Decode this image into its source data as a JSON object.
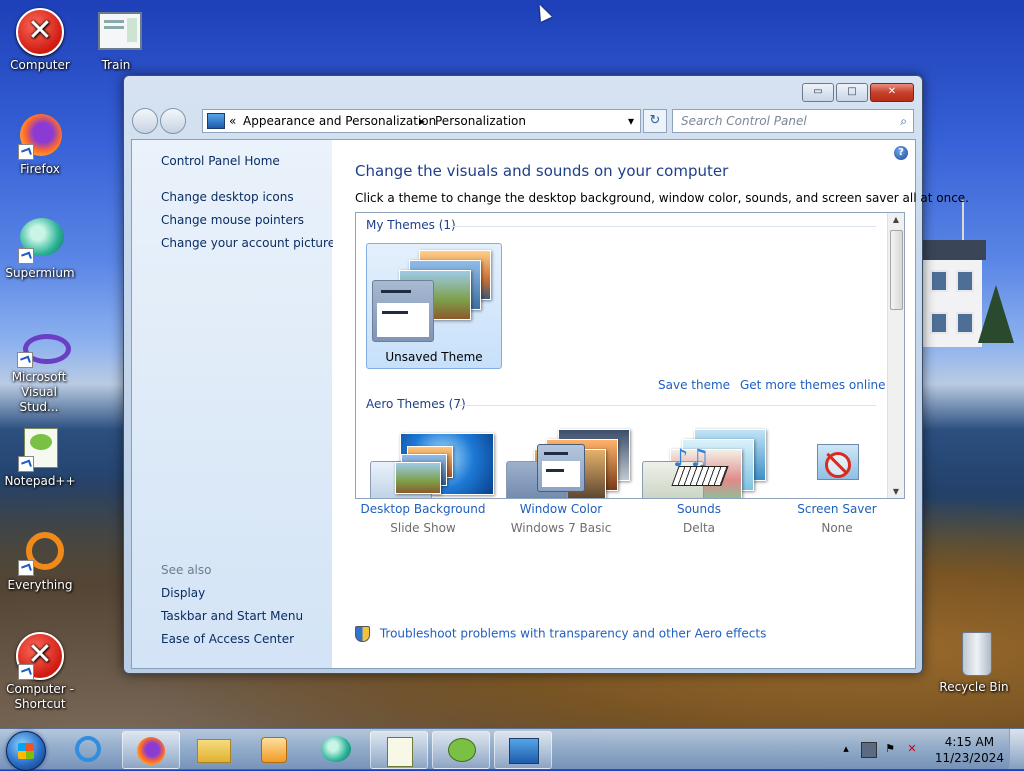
{
  "desktop": {
    "icons": [
      {
        "label": "Computer"
      },
      {
        "label": "Train"
      },
      {
        "label": "Firefox"
      },
      {
        "label": "Supermium"
      },
      {
        "label": "Microsoft Visual Stud..."
      },
      {
        "label": "Notepad++"
      },
      {
        "label": "Everything"
      },
      {
        "label": "Computer - Shortcut"
      },
      {
        "label": "Recycle Bin"
      }
    ]
  },
  "window": {
    "controls": {
      "minimize": "▭",
      "maximize": "□",
      "close": "✕"
    },
    "address": {
      "chevron": "«",
      "crumb1": "Appearance and Personalization",
      "separator": "▸",
      "crumb2": "Personalization",
      "dropdown": "▾"
    },
    "refresh_glyph": "↻",
    "search": {
      "placeholder": "Search Control Panel",
      "icon": "⌕"
    }
  },
  "sidebar": {
    "home": "Control Panel Home",
    "links": [
      "Change desktop icons",
      "Change mouse pointers",
      "Change your account picture"
    ],
    "see_also_title": "See also",
    "see_also": [
      "Display",
      "Taskbar and Start Menu",
      "Ease of Access Center"
    ]
  },
  "content": {
    "help": "?",
    "heading": "Change the visuals and sounds on your computer",
    "subtext": "Click a theme to change the desktop background, window color, sounds, and screen saver all at once.",
    "my_themes_title": "My Themes (1)",
    "unsaved_theme": "Unsaved Theme",
    "save_theme": "Save theme",
    "get_more": "Get more themes online",
    "aero_title": "Aero Themes (7)",
    "settings": [
      {
        "title": "Desktop Background",
        "value": "Slide Show",
        "icon": "photos-icon"
      },
      {
        "title": "Window Color",
        "value": "Windows 7 Basic",
        "icon": "window-color-icon"
      },
      {
        "title": "Sounds",
        "value": "Delta",
        "icon": "music-icon"
      },
      {
        "title": "Screen Saver",
        "value": "None",
        "icon": "screen-saver-icon"
      }
    ],
    "troubleshoot": "Troubleshoot problems with transparency and other Aero effects"
  },
  "taskbar": {
    "time": "4:15 AM",
    "date": "11/23/2024",
    "tray_arrow": "▴"
  }
}
